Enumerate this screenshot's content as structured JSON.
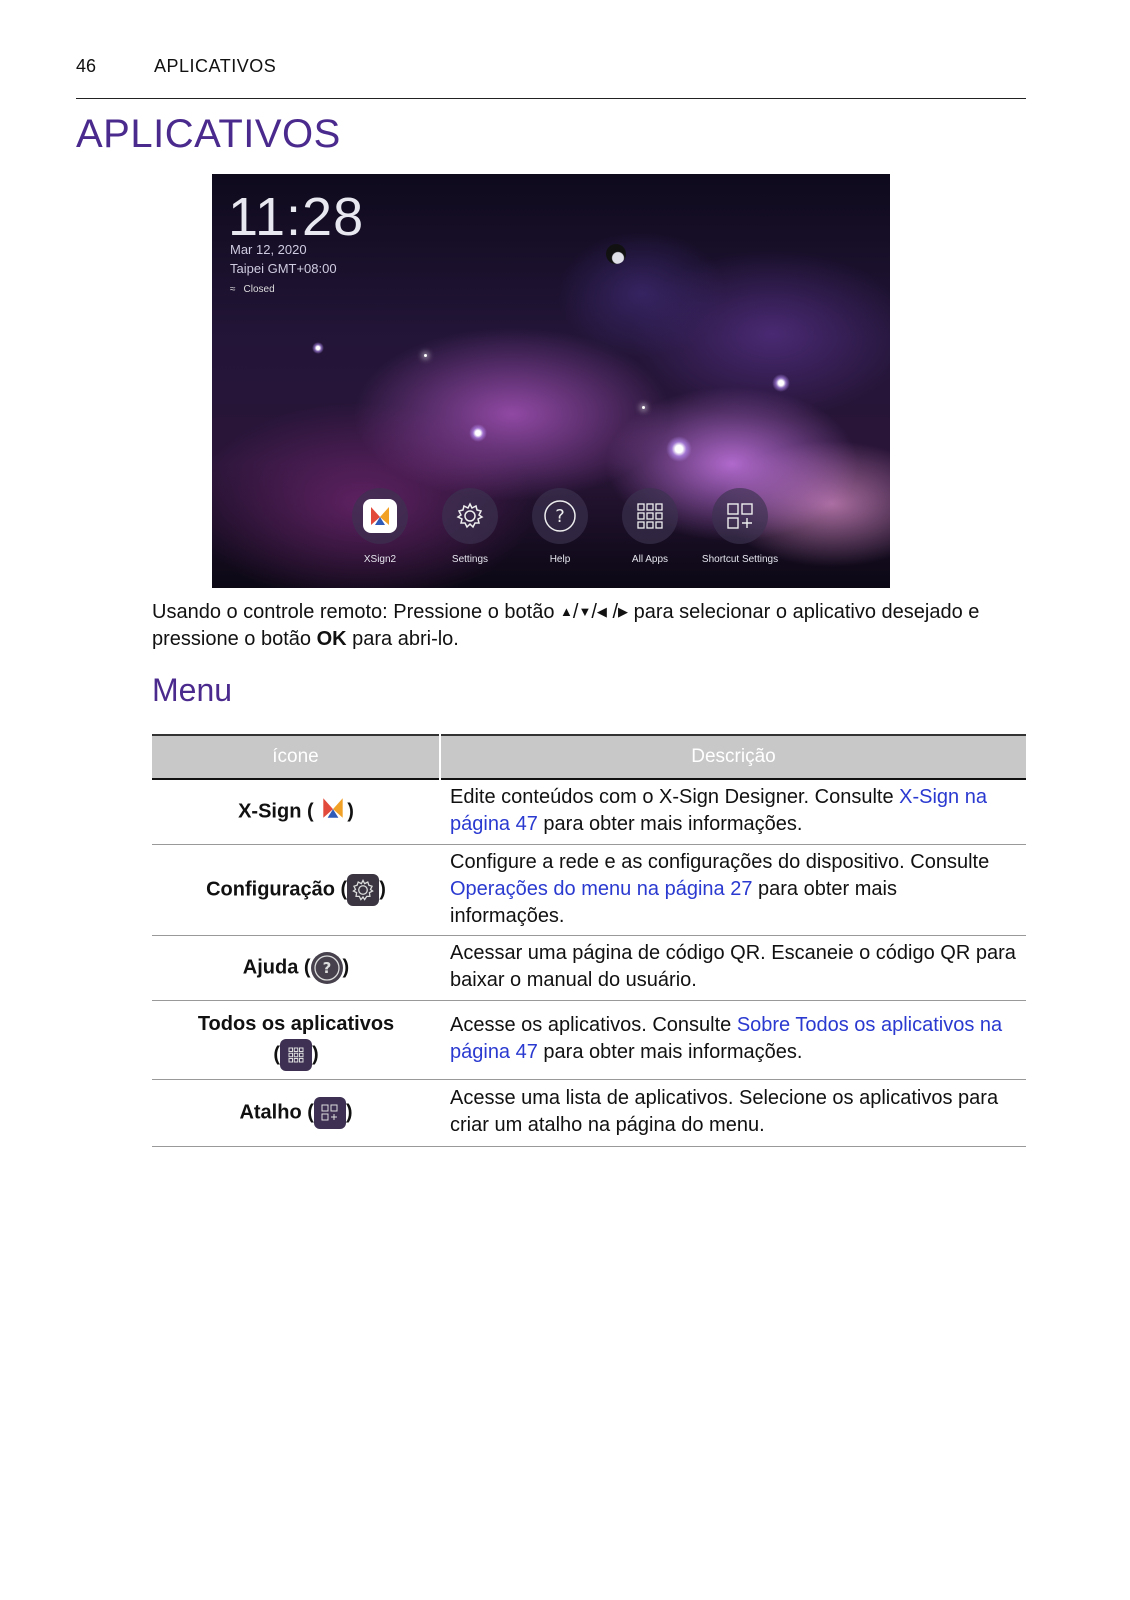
{
  "header": {
    "page_number": "46",
    "section": "APLICATIVOS"
  },
  "title": "APLICATIVOS",
  "screenshot": {
    "time": "11:28",
    "date": "Mar 12, 2020",
    "timezone": "Taipei  GMT+08:00",
    "network": "Closed",
    "apps": [
      {
        "label": "XSign2",
        "icon": "xsign-icon"
      },
      {
        "label": "Settings",
        "icon": "gear-icon"
      },
      {
        "label": "Help",
        "icon": "help-icon"
      },
      {
        "label": "All Apps",
        "icon": "grid-icon"
      },
      {
        "label": "Shortcut Settings",
        "icon": "shortcut-icon"
      }
    ]
  },
  "intro": {
    "part1": "Usando o controle remoto: Pressione o botão",
    "part2": "para selecionar o aplicativo desejado e pressione o botão",
    "ok": "OK",
    "part3": "para abri-lo."
  },
  "subtitle": "Menu",
  "table": {
    "headers": [
      "ícone",
      "Descrição"
    ],
    "rows": [
      {
        "icon_label": "X-Sign",
        "desc_before": "Edite conteúdos com o X-Sign Designer. Consulte ",
        "link": "X-Sign na página 47",
        "desc_after": " para obter mais informações."
      },
      {
        "icon_label": "Configuração",
        "desc_before": "Configure a rede e as configurações do dispositivo. Consulte ",
        "link": "Operações do menu na página 27",
        "desc_after": " para obter mais informações."
      },
      {
        "icon_label": "Ajuda",
        "desc_before": "Acessar uma página de código QR. Escaneie o código QR para baixar o manual do usuário.",
        "link": "",
        "desc_after": ""
      },
      {
        "icon_label": "Todos os aplicativos",
        "desc_before": "Acesse os aplicativos. Consulte ",
        "link": "Sobre Todos os aplicativos na página 47",
        "desc_after": " para obter mais informações."
      },
      {
        "icon_label": "Atalho",
        "desc_before": "Acesse uma lista de aplicativos. Selecione os aplicativos para criar um atalho na página do menu.",
        "link": "",
        "desc_after": ""
      }
    ]
  },
  "colors": {
    "heading": "#4b2a8e",
    "link": "#2a3ad0",
    "table_header_bg": "#c8c8c8"
  }
}
